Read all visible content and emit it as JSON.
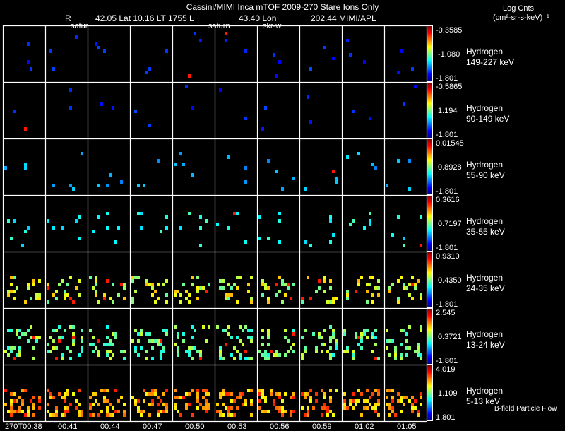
{
  "header": {
    "title": "Cassini/MIMI Inca mTOF  2009-270   Stare   Ions Only",
    "line2": {
      "r_label": "R",
      "r_value": "42.05 Lat 10.16 LT 1755 L",
      "l_value": "43.40 Lon",
      "lon_value": "202.44  MIMI/APL"
    },
    "markers": [
      "satur",
      "saturn",
      "skr-wl"
    ]
  },
  "units": {
    "line1": "Log Cnts",
    "line2": "(cm²-sr-s-keV)⁻¹"
  },
  "footer_note": "B-field Particle Flow",
  "colors": {
    "background": "#000000",
    "frame": "#ffffff",
    "jet_low": "#00008f",
    "jet_high": "#800000"
  },
  "chart_data": {
    "type": "heatmap",
    "title": "Cassini/MIMI Inca mTOF  2009-270   Stare   Ions Only",
    "colormap": "jet",
    "x_tick_labels": [
      "270T00:38",
      "00:41",
      "00:44",
      "00:47",
      "00:50",
      "00:53",
      "00:56",
      "00:59",
      "01:02",
      "01:05"
    ],
    "rows": [
      {
        "species": "Hydrogen",
        "energy": "149-227 keV",
        "max": "-0.3585",
        "mid": "-1.080",
        "min": "-1.801"
      },
      {
        "species": "Hydrogen",
        "energy": "90-149 keV",
        "max": "-0.5865",
        "mid": "1.194",
        "min": "-1.801"
      },
      {
        "species": "Hydrogen",
        "energy": "55-90 keV",
        "max": "0.01545",
        "mid": "0.8928",
        "min": "-1.801"
      },
      {
        "species": "Hydrogen",
        "energy": "35-55 keV",
        "max": "0.3616",
        "mid": "0.7197",
        "min": "-1.801"
      },
      {
        "species": "Hydrogen",
        "energy": "24-35 keV",
        "max": "0.9310",
        "mid": "0.4350",
        "min": "-1.801"
      },
      {
        "species": "Hydrogen",
        "energy": "13-24 keV",
        "max": "2.545",
        "mid": "0.3721",
        "min": "-1.801"
      },
      {
        "species": "Hydrogen",
        "energy": "5-13 keV",
        "max": "4.019",
        "mid": "1.109",
        "min": "1.801"
      }
    ]
  }
}
